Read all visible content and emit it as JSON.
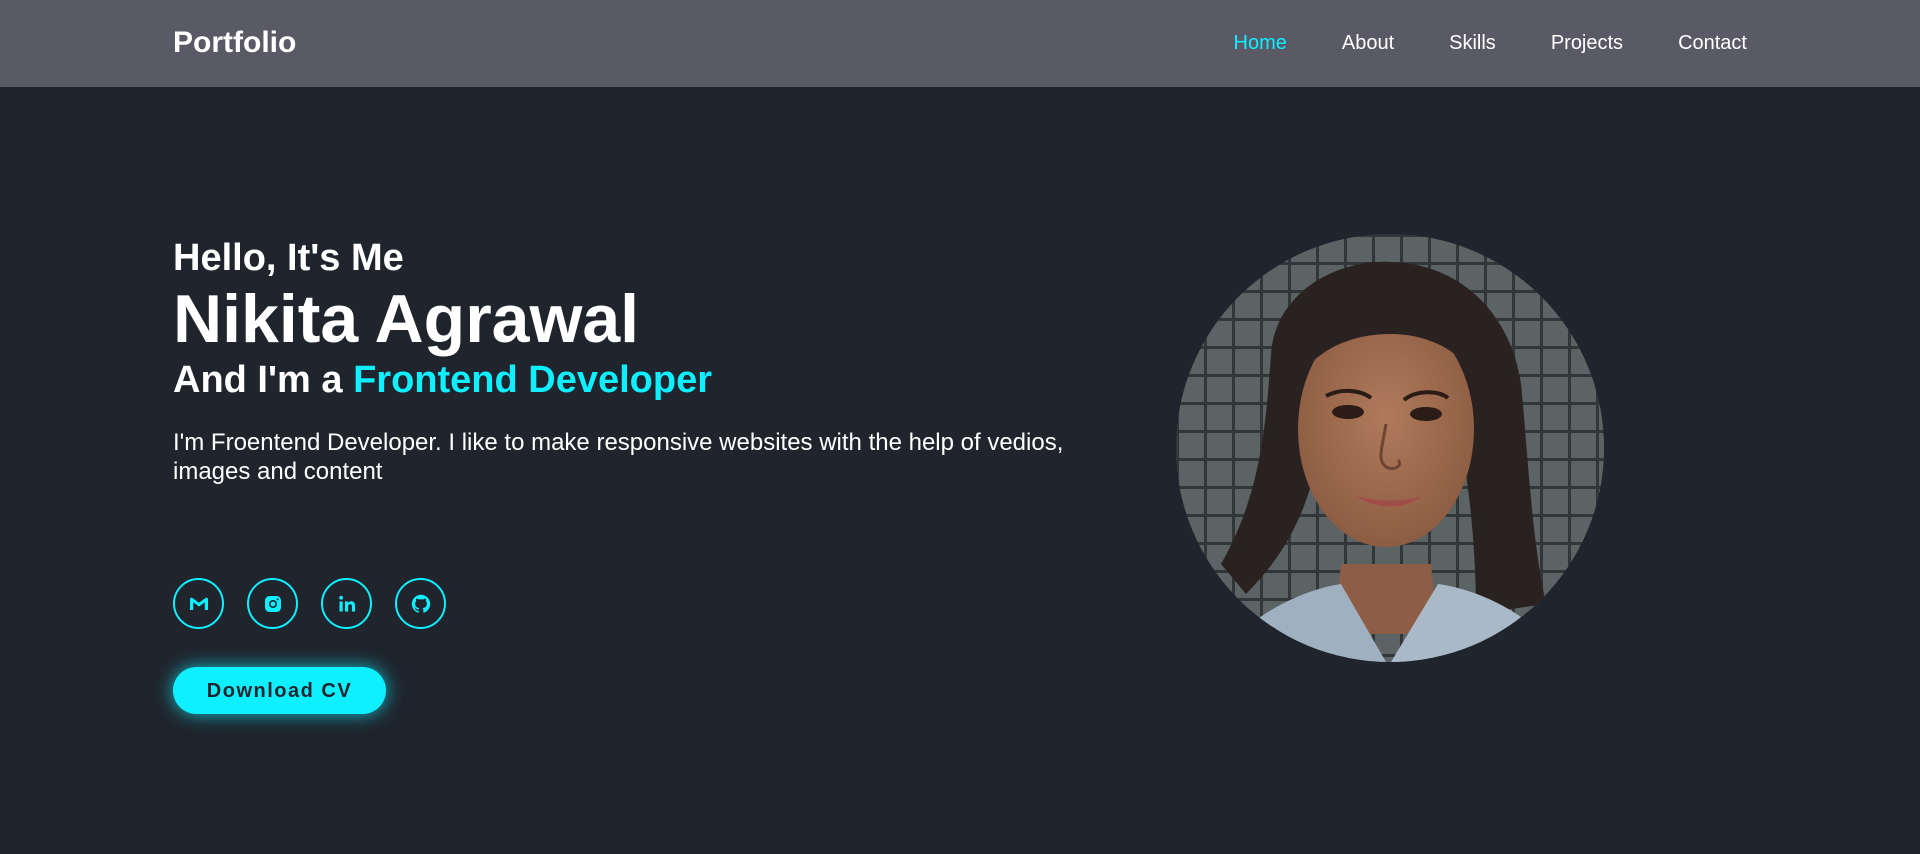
{
  "header": {
    "logo": "Portfolio",
    "nav": [
      {
        "label": "Home",
        "active": true
      },
      {
        "label": "About",
        "active": false
      },
      {
        "label": "Skills",
        "active": false
      },
      {
        "label": "Projects",
        "active": false
      },
      {
        "label": "Contact",
        "active": false
      }
    ]
  },
  "hero": {
    "greeting": "Hello, It's Me",
    "name": "Nikita Agrawal",
    "role_prefix": "And I'm a",
    "role": "Frontend Developer",
    "bio": "I'm Froentend Developer. I like to make responsive websites with the help of vedios, images and content",
    "socials": [
      {
        "icon": "gmail-icon"
      },
      {
        "icon": "instagram-icon"
      },
      {
        "icon": "linkedin-icon"
      },
      {
        "icon": "github-icon"
      }
    ],
    "cv_button": "Download CV"
  },
  "colors": {
    "accent": "#0ef0ff",
    "background": "#1f242d",
    "navbar": "#5a5966",
    "text": "#ffffff"
  }
}
